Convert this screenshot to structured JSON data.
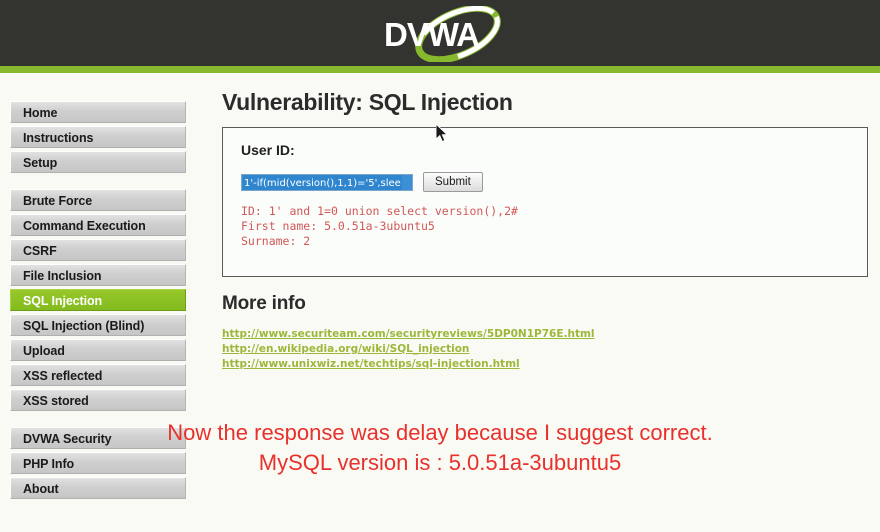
{
  "header": {
    "logo_text": "DVWA",
    "accent_color": "#87b82e",
    "bar_color": "#333330"
  },
  "sidebar": {
    "groups": [
      {
        "items": [
          {
            "label": "Home",
            "active": false
          },
          {
            "label": "Instructions",
            "active": false
          },
          {
            "label": "Setup",
            "active": false
          }
        ]
      },
      {
        "items": [
          {
            "label": "Brute Force",
            "active": false
          },
          {
            "label": "Command Execution",
            "active": false
          },
          {
            "label": "CSRF",
            "active": false
          },
          {
            "label": "File Inclusion",
            "active": false
          },
          {
            "label": "SQL Injection",
            "active": true
          },
          {
            "label": "SQL Injection (Blind)",
            "active": false
          },
          {
            "label": "Upload",
            "active": false
          },
          {
            "label": "XSS reflected",
            "active": false
          },
          {
            "label": "XSS stored",
            "active": false
          }
        ]
      },
      {
        "items": [
          {
            "label": "DVWA Security",
            "active": false
          },
          {
            "label": "PHP Info",
            "active": false
          },
          {
            "label": "About",
            "active": false
          }
        ]
      }
    ]
  },
  "main": {
    "page_title": "Vulnerability: SQL Injection",
    "form": {
      "label": "User ID:",
      "input_value": "1'-if(mid(version(),1,1)='5',slee",
      "input_selected": true,
      "submit_label": "Submit"
    },
    "result": {
      "line1": "ID: 1' and 1=0 union select version(),2#",
      "line2": "First name: 5.0.51a-3ubuntu5",
      "line3": "Surname: 2",
      "color": "#d05858"
    },
    "more_info": {
      "title": "More info",
      "links": [
        "http://www.securiteam.com/securityreviews/5DP0N1P76E.html",
        "http://en.wikipedia.org/wiki/SQL_injection",
        "http://www.unixwiz.net/techtips/sql-injection.html"
      ],
      "link_color": "#9bb83a"
    }
  },
  "annotation": {
    "line1": "Now the response was delay because I suggest correct.",
    "line2": "MySQL version is : 5.0.51a-3ubuntu5",
    "color": "#e8302c"
  }
}
